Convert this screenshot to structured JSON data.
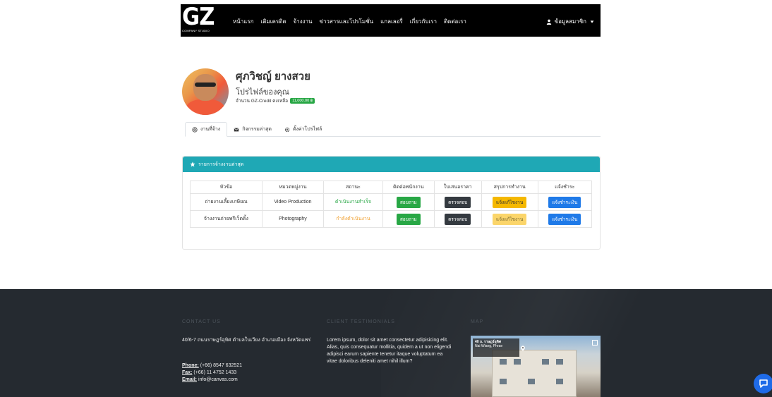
{
  "header": {
    "logo_text": "GZ",
    "logo_subtext": "COMPANY STUDIO",
    "nav": [
      {
        "label": "หน้าแรก"
      },
      {
        "label": "เติมเครดิต"
      },
      {
        "label": "จ้างงาน"
      },
      {
        "label": "ข่าวสารและโปรโมชั่น"
      },
      {
        "label": "แกลเลอรี่"
      },
      {
        "label": "เกี่ยวกับเรา"
      },
      {
        "label": "ติดต่อเรา"
      }
    ],
    "user_menu_label": "ข้อมูลสมาชิก"
  },
  "profile": {
    "name": "ศุภวิชญ์ ยางสวย",
    "subtitle": "โปรไฟล์ของคุณ",
    "credit_label": "จำนวน GZ-Credit คงเหลือ",
    "credit_value": "11,000.00 ฿"
  },
  "tabs": [
    {
      "label": "งานที่จ้าง",
      "icon": "at-icon"
    },
    {
      "label": "กิจกรรมล่าสุด",
      "icon": "envelope-icon"
    },
    {
      "label": "ตั้งค่าโปรไฟล์",
      "icon": "gear-icon"
    }
  ],
  "jobs_card": {
    "title": "รายการจ้างงานล่าสุด",
    "columns": [
      "หัวข้อ",
      "หมวดหมู่งาน",
      "สถานะ",
      "ติดต่อพนักงาน",
      "ใบเสนอราคา",
      "สรุปการทำงาน",
      "แจ้งชำระ"
    ],
    "rows": [
      {
        "topic": "ถ่ายงานเลี้ยงเกษียณ",
        "category": "Video Production",
        "status": "ดำเนินงานสำเร็จ",
        "contact_btn": "สอบถาม",
        "quote_btn": "ตรวจสอบ",
        "summary_btn": "แจ้งแก้ไขงาน",
        "pay_btn": "แจ้งชำระเงิน"
      },
      {
        "topic": "จ้างงานถ่ายพรีเว็ดดิ้ง",
        "category": "Photography",
        "status": "กำลังดำเนินงาน",
        "contact_btn": "สอบถาม",
        "quote_btn": "ตรวจสอบ",
        "summary_btn": "แจ้งแก้ไขงาน",
        "pay_btn": "แจ้งชำระเงิน"
      }
    ]
  },
  "footer": {
    "contact_title": "CONTACT US",
    "address": "40/6-7 ถนนราษฎร์อุทิศ ตำบลในเวียง อำเภอเมือง จังหวัดแพร่",
    "phone_label": "Phone:",
    "phone": "(+66) 8547 632521",
    "fax_label": "Fax:",
    "fax": "(+66) 11 4752 1433",
    "email_label": "Email:",
    "email": "info@canvas.com",
    "testimonials_title": "CLIENT TESTIMONIALS",
    "testimonial": "Lorem ipsum, dolor sit amet consectetur adipisicing elit. Alias, quis consequatur mollitia, quidem a ut non eligendi adipisci earum sapiente tenetur itaque voluptatum ea vitae doloribus deleniti amet nihil illum?",
    "map_title": "MAP",
    "map_place": "40 ถ. ราษฎร์อุทิศ",
    "map_area": "Nai Wiang, Phrae"
  },
  "colors": {
    "navbar": "#000000",
    "card_header": "#1fa8b5",
    "footer": "#252a30",
    "success": "#28a745",
    "warning": "#f5b800",
    "primary": "#1f7ae8"
  }
}
